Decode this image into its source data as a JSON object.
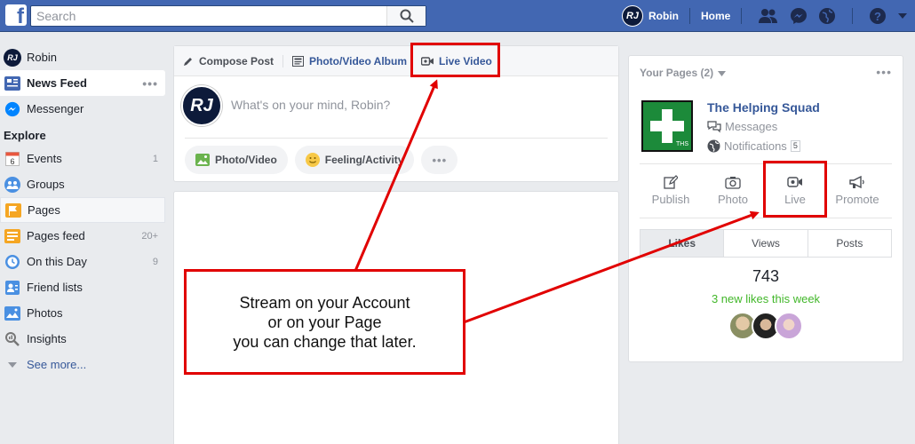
{
  "topbar": {
    "search_placeholder": "Search",
    "avatar_initials": "RJ",
    "user_name": "Robin",
    "home_label": "Home"
  },
  "sidebar": {
    "user": {
      "initials": "RJ",
      "name": "Robin"
    },
    "items": [
      {
        "label": "News Feed",
        "more": "•••"
      },
      {
        "label": "Messenger"
      }
    ],
    "explore_heading": "Explore",
    "explore": [
      {
        "label": "Events",
        "count": "1",
        "icon_text": "6"
      },
      {
        "label": "Groups",
        "count": ""
      },
      {
        "label": "Pages",
        "count": ""
      },
      {
        "label": "Pages feed",
        "count": "20+"
      },
      {
        "label": "On this Day",
        "count": "9"
      },
      {
        "label": "Friend lists",
        "count": ""
      },
      {
        "label": "Photos",
        "count": ""
      },
      {
        "label": "Insights",
        "count": ""
      }
    ],
    "see_more": "See more..."
  },
  "composer": {
    "tabs": [
      "Compose Post",
      "Photo/Video Album",
      "Live Video"
    ],
    "avatar_initials": "RJ",
    "placeholder": "What's on your mind, Robin?",
    "buttons": [
      "Photo/Video",
      "Feeling/Activity",
      "•••"
    ]
  },
  "pages_box": {
    "header": "Your Pages (2)",
    "more": "•••",
    "page_logo_text": "THS",
    "page_name": "The Helping Squad",
    "messages_label": "Messages",
    "notifications_label": "Notifications",
    "notifications_count": "5",
    "actions": [
      "Publish",
      "Photo",
      "Live",
      "Promote"
    ],
    "stat_tabs": [
      "Likes",
      "Views",
      "Posts"
    ],
    "likes_count": "743",
    "new_likes": "3 new likes this week"
  },
  "annotation": {
    "lines": [
      "Stream on your Account",
      "or on your Page",
      "you can change that later."
    ],
    "color": "#e10000"
  }
}
